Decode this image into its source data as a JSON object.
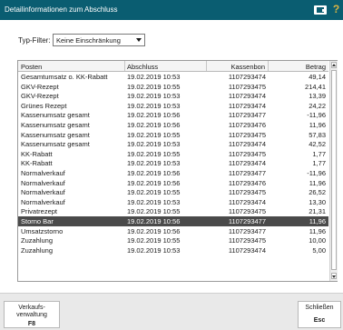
{
  "window": {
    "title": "Detailinformationen zum Abschluss",
    "help_glyph": "?"
  },
  "filter": {
    "label": "Typ-Filter:",
    "value": "Keine Einschränkung"
  },
  "table": {
    "headers": {
      "posten": "Posten",
      "abschluss": "Abschluss",
      "kassenbon": "Kassenbon",
      "betrag": "Betrag"
    },
    "rows": [
      {
        "posten": "Gesamtumsatz o. KK-Rabatt",
        "abschluss": "19.02.2019 10:53",
        "kassenbon": "1107293474",
        "betrag": "49,14"
      },
      {
        "posten": "GKV-Rezept",
        "abschluss": "19.02.2019 10:55",
        "kassenbon": "1107293475",
        "betrag": "214,41"
      },
      {
        "posten": "GKV-Rezept",
        "abschluss": "19.02.2019 10:53",
        "kassenbon": "1107293474",
        "betrag": "13,39"
      },
      {
        "posten": "Grünes Rezept",
        "abschluss": "19.02.2019 10:53",
        "kassenbon": "1107293474",
        "betrag": "24,22"
      },
      {
        "posten": "Kassenumsatz gesamt",
        "abschluss": "19.02.2019 10:56",
        "kassenbon": "1107293477",
        "betrag": "-11,96"
      },
      {
        "posten": "Kassenumsatz gesamt",
        "abschluss": "19.02.2019 10:56",
        "kassenbon": "1107293476",
        "betrag": "11,96"
      },
      {
        "posten": "Kassenumsatz gesamt",
        "abschluss": "19.02.2019 10:55",
        "kassenbon": "1107293475",
        "betrag": "57,83"
      },
      {
        "posten": "Kassenumsatz gesamt",
        "abschluss": "19.02.2019 10:53",
        "kassenbon": "1107293474",
        "betrag": "42,52"
      },
      {
        "posten": "KK-Rabatt",
        "abschluss": "19.02.2019 10:55",
        "kassenbon": "1107293475",
        "betrag": "1,77"
      },
      {
        "posten": "KK-Rabatt",
        "abschluss": "19.02.2019 10:53",
        "kassenbon": "1107293474",
        "betrag": "1,77"
      },
      {
        "posten": "Normalverkauf",
        "abschluss": "19.02.2019 10:56",
        "kassenbon": "1107293477",
        "betrag": "-11,96"
      },
      {
        "posten": "Normalverkauf",
        "abschluss": "19.02.2019 10:56",
        "kassenbon": "1107293476",
        "betrag": "11,96"
      },
      {
        "posten": "Normalverkauf",
        "abschluss": "19.02.2019 10:55",
        "kassenbon": "1107293475",
        "betrag": "26,52"
      },
      {
        "posten": "Normalverkauf",
        "abschluss": "19.02.2019 10:53",
        "kassenbon": "1107293474",
        "betrag": "13,30"
      },
      {
        "posten": "Privatrezept",
        "abschluss": "19.02.2019 10:55",
        "kassenbon": "1107293475",
        "betrag": "21,31"
      },
      {
        "posten": "Storno Bar",
        "abschluss": "19.02.2019 10:56",
        "kassenbon": "1107293477",
        "betrag": "11,96",
        "selected": true
      },
      {
        "posten": "Umsatzstorno",
        "abschluss": "19.02.2019 10:56",
        "kassenbon": "1107293477",
        "betrag": "11,96"
      },
      {
        "posten": "Zuzahlung",
        "abschluss": "19.02.2019 10:55",
        "kassenbon": "1107293475",
        "betrag": "10,00"
      },
      {
        "posten": "Zuzahlung",
        "abschluss": "19.02.2019 10:53",
        "kassenbon": "1107293474",
        "betrag": "5,00"
      }
    ]
  },
  "footer": {
    "verkauf_line1": "Verkaufs-",
    "verkauf_line2": "verwaltung",
    "verkauf_key": "F8",
    "schliessen_label": "Schließen",
    "schliessen_key": "Esc"
  },
  "colors": {
    "titlebar": "#0a5d71",
    "selected_row": "#4a4a4a",
    "help_icon": "#d9b342"
  },
  "icons": {
    "titlebar_window": "window-icon",
    "help": "help-icon"
  }
}
